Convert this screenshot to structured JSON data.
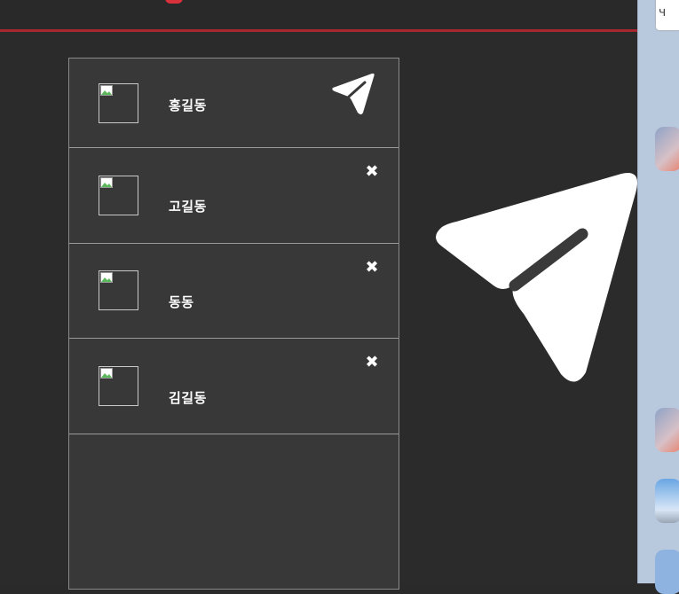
{
  "chat_list": {
    "items": [
      {
        "name": "홍길동",
        "action": "send-icon"
      },
      {
        "name": "고길동",
        "action": "close-icon"
      },
      {
        "name": "동동",
        "action": "close-icon"
      },
      {
        "name": "김길동",
        "action": "close-icon"
      }
    ]
  },
  "icons": {
    "close": "✖",
    "send": "send-icon"
  },
  "colors": {
    "accent": "#d9313b",
    "panel_bg": "#383838",
    "app_bg": "#2b2b2b",
    "side_strip": "#b9c9dd"
  },
  "side_strip": {
    "card_glyph": "ч"
  }
}
